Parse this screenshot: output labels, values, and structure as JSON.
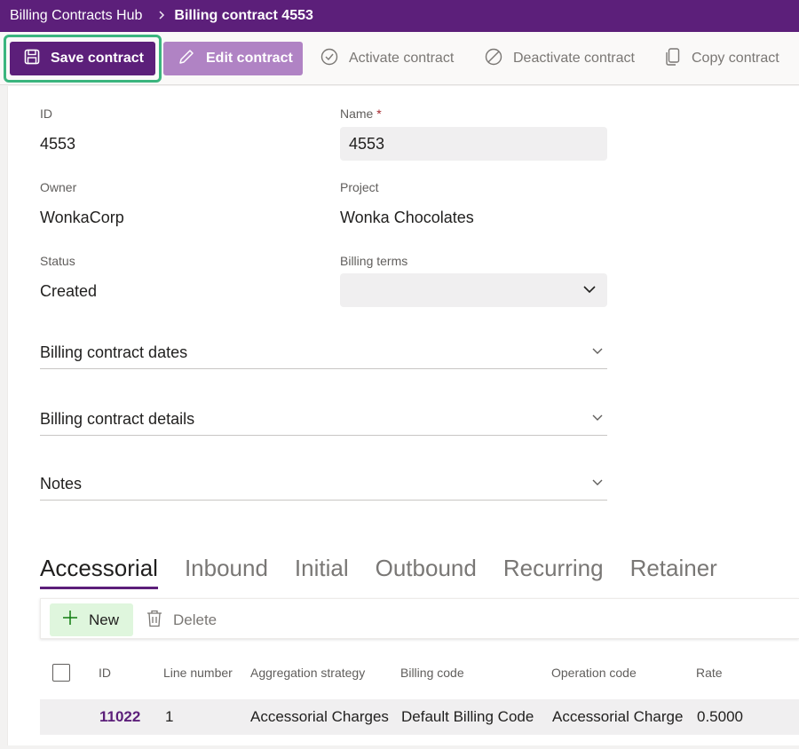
{
  "header": {
    "app_name": "Billing Contracts Hub",
    "current_page": "Billing contract 4553"
  },
  "toolbar": {
    "save_label": "Save contract",
    "edit_label": "Edit contract",
    "activate_label": "Activate contract",
    "deactivate_label": "Deactivate contract",
    "copy_label": "Copy contract"
  },
  "form": {
    "id_label": "ID",
    "id_value": "4553",
    "name_label": "Name",
    "name_required": "*",
    "name_value": "4553",
    "owner_label": "Owner",
    "owner_value": "WonkaCorp",
    "project_label": "Project",
    "project_value": "Wonka Chocolates",
    "status_label": "Status",
    "status_value": "Created",
    "billing_terms_label": "Billing terms",
    "billing_terms_value": ""
  },
  "sections": [
    {
      "label": "Billing contract dates"
    },
    {
      "label": "Billing contract details"
    },
    {
      "label": "Notes"
    }
  ],
  "tabs": [
    {
      "label": "Accessorial",
      "active": true
    },
    {
      "label": "Inbound"
    },
    {
      "label": "Initial"
    },
    {
      "label": "Outbound"
    },
    {
      "label": "Recurring"
    },
    {
      "label": "Retainer"
    }
  ],
  "grid_toolbar": {
    "new_label": "New",
    "delete_label": "Delete"
  },
  "grid": {
    "columns": [
      "ID",
      "Line number",
      "Aggregation strategy",
      "Billing code",
      "Operation code",
      "Rate"
    ],
    "rows": [
      {
        "id": "11022",
        "line_number": "1",
        "aggregation_strategy": "Accessorial Charges",
        "billing_code": "Default Billing Code",
        "operation_code": "Accessorial Charge",
        "rate": "0.5000"
      }
    ]
  },
  "colors": {
    "brand": "#5c1f7a",
    "focus_ring": "#3bb57e",
    "new_button_bg": "#dff6dd"
  }
}
